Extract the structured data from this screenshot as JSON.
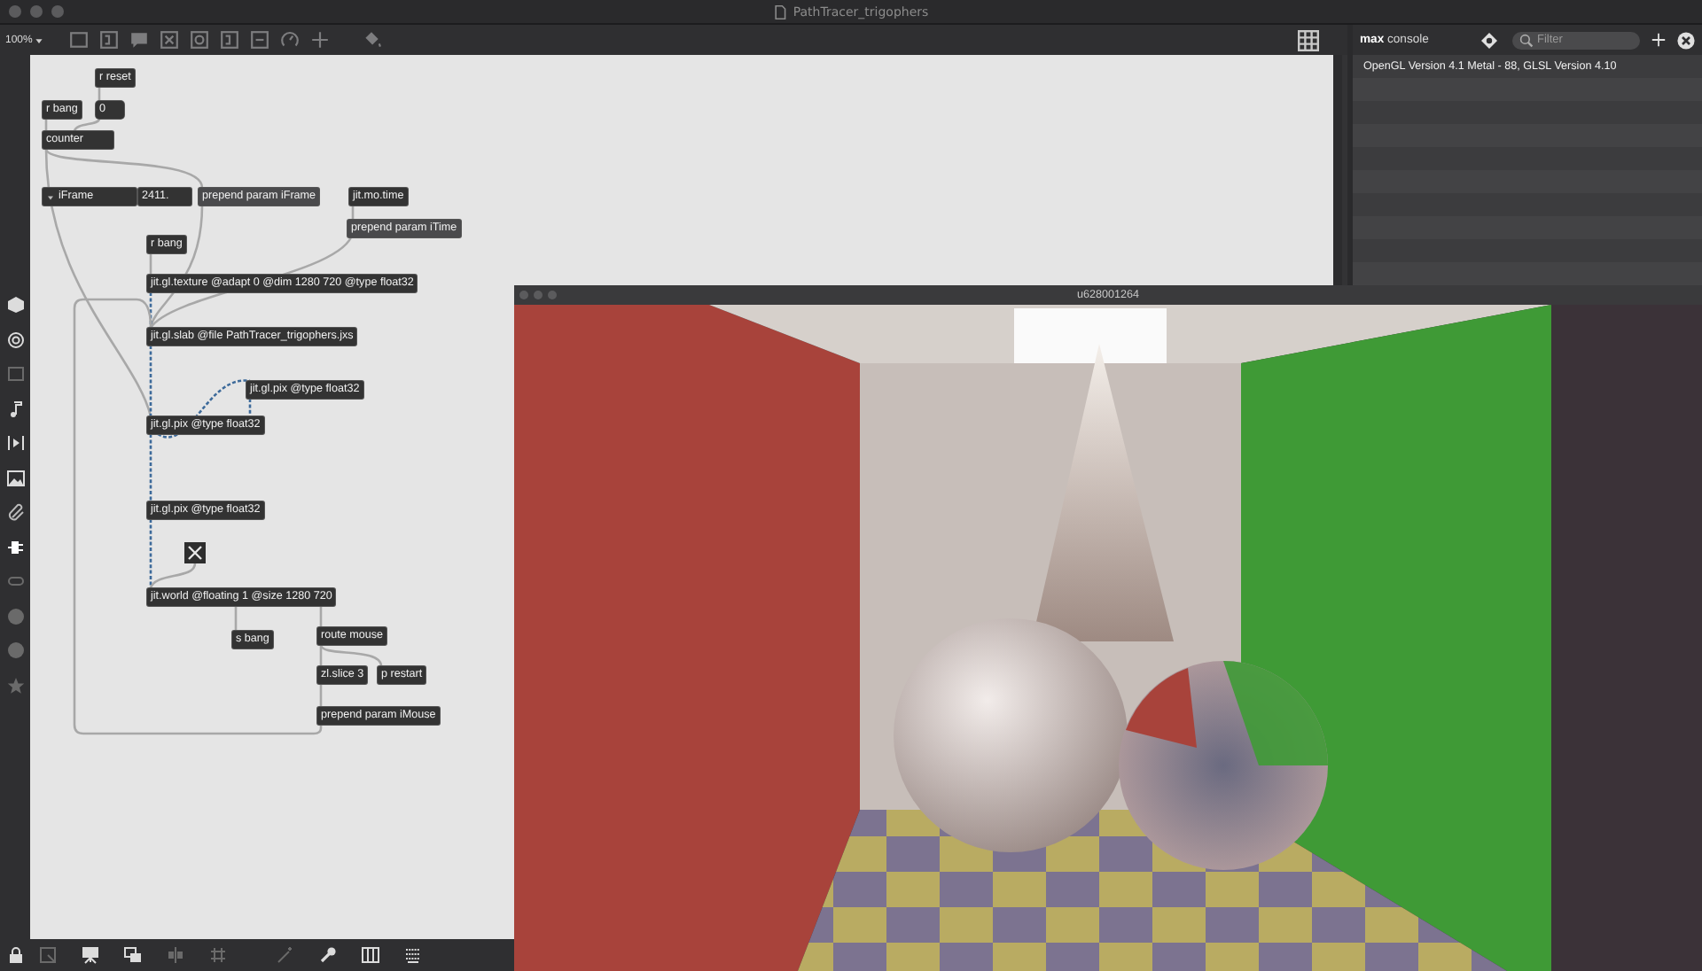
{
  "window": {
    "title": "PathTracer_trigophers"
  },
  "toolbar": {
    "zoom": "100%"
  },
  "patcher": {
    "objects": [
      {
        "kind": "object",
        "text": "r reset"
      },
      {
        "kind": "object",
        "text": "r bang"
      },
      {
        "kind": "number",
        "value": "0"
      },
      {
        "kind": "object",
        "text": "counter"
      },
      {
        "kind": "attrui",
        "label": "iFrame",
        "value": "2411."
      },
      {
        "kind": "message",
        "text": "prepend param iFrame"
      },
      {
        "kind": "object",
        "text": "jit.mo.time"
      },
      {
        "kind": "message",
        "text": "prepend param iTime"
      },
      {
        "kind": "object",
        "text": "r bang"
      },
      {
        "kind": "object",
        "text": "jit.gl.texture @adapt 0 @dim 1280 720 @type float32"
      },
      {
        "kind": "object",
        "text": "jit.gl.slab @file PathTracer_trigophers.jxs"
      },
      {
        "kind": "object",
        "text": "jit.gl.pix @type float32"
      },
      {
        "kind": "object",
        "text": "jit.gl.pix @type float32"
      },
      {
        "kind": "object",
        "text": "jit.gl.pix @type float32"
      },
      {
        "kind": "toggle",
        "checked": true
      },
      {
        "kind": "object",
        "text": "jit.world @floating 1 @size 1280 720"
      },
      {
        "kind": "object",
        "text": "s bang"
      },
      {
        "kind": "object",
        "text": "route mouse"
      },
      {
        "kind": "object",
        "text": "zl.slice 3"
      },
      {
        "kind": "object",
        "text": "p restart"
      },
      {
        "kind": "object",
        "text": "prepend param iMouse"
      }
    ]
  },
  "console": {
    "title": "**max** console",
    "filter": {
      "placeholder": "Filter"
    },
    "messages": [
      "OpenGL Version 4.1 Metal - 88, GLSL Version 4.10"
    ]
  },
  "render_window": {
    "title": "u628001264"
  }
}
